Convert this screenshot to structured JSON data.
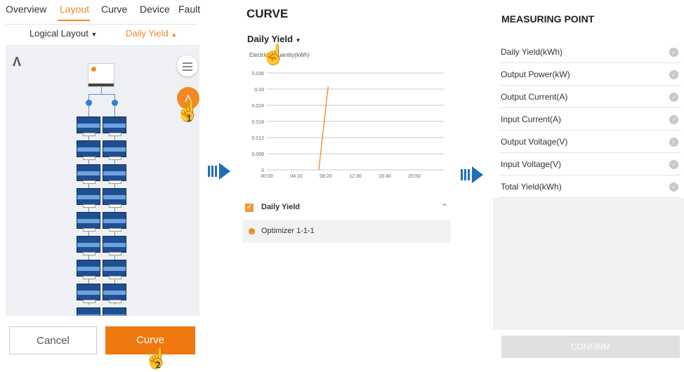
{
  "panel1": {
    "tabs": [
      "Overview",
      "Layout",
      "Curve",
      "Device",
      "Fault"
    ],
    "active_tab": "Layout",
    "layout_selector": "Logical Layout",
    "yield_selector": "Daily Yield",
    "cancel_label": "Cancel",
    "curve_label": "Curve",
    "step1": "1",
    "step2": "2"
  },
  "panel2": {
    "title": "CURVE",
    "selector": "Daily Yield",
    "legend_label": "Daily Yield",
    "series_label": "Optimizer 1-1-1"
  },
  "chart_data": {
    "type": "line",
    "ylabel": "Electricity quantity(kWh)",
    "x_ticks": [
      "00:00",
      "04:10",
      "08:20",
      "12:30",
      "16:40",
      "20:50"
    ],
    "y_ticks": [
      "0",
      "0.006",
      "0.012",
      "0.018",
      "0.024",
      "0.03",
      "0.036"
    ],
    "ylim": [
      0,
      0.036
    ],
    "series": [
      {
        "name": "Optimizer 1-1-1",
        "x": [
          "07:20",
          "08:40"
        ],
        "y": [
          0,
          0.031
        ]
      }
    ]
  },
  "panel3": {
    "title": "MEASURING POINT",
    "items": [
      "Daily Yield(kWh)",
      "Output Power(kW)",
      "Output Current(A)",
      "Input Current(A)",
      "Output Voltage(V)",
      "Input Voltage(V)",
      "Total Yield(kWh)"
    ],
    "confirm_label": "CONFIRM"
  },
  "colors": {
    "accent": "#f08a24",
    "arrow": "#1e6fb8",
    "panel_module": "#1f4f8f"
  }
}
